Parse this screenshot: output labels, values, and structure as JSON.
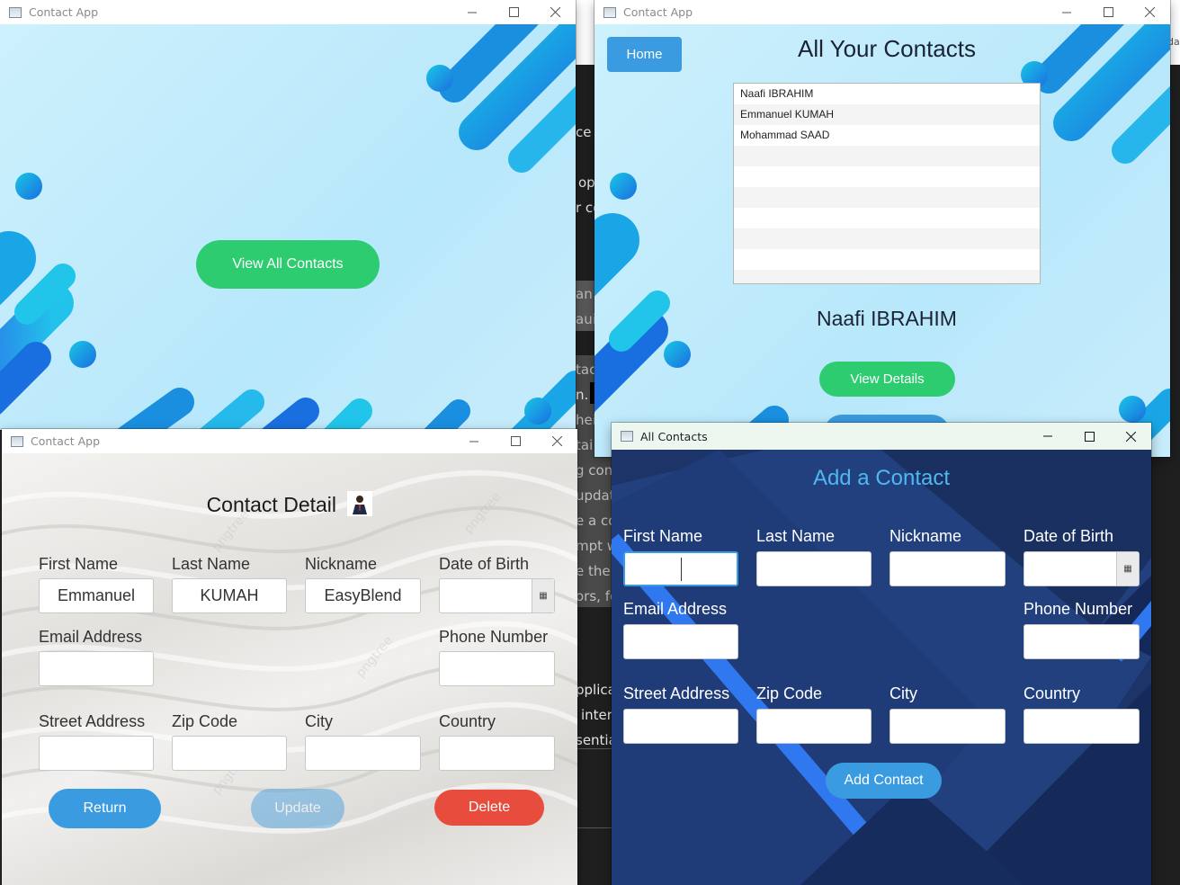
{
  "background_window": {
    "text_fragments": [
      "ce c",
      "op",
      "r co",
      "an",
      "aui",
      "tac",
      "n.",
      "hei",
      "tai",
      "g cont",
      "updat",
      "e a co",
      "mpt w",
      "e the",
      "ors, fo",
      "pplica",
      "inter",
      "sentia",
      "da"
    ]
  },
  "home_window": {
    "title": "Contact App",
    "view_all_label": "View All Contacts"
  },
  "list_window": {
    "title": "Contact App",
    "home_label": "Home",
    "heading": "All Your Contacts",
    "contacts": [
      "Naafi IBRAHIM",
      "Emmanuel KUMAH",
      "Mohammad SAAD"
    ],
    "selected_name": "Naafi IBRAHIM",
    "view_details_label": "View Details"
  },
  "detail_window": {
    "title": "Contact App",
    "heading": "Contact Detail",
    "labels": {
      "first_name": "First Name",
      "last_name": "Last Name",
      "nickname": "Nickname",
      "dob": "Date of Birth",
      "email": "Email Address",
      "phone": "Phone Number",
      "street": "Street Address",
      "zip": "Zip Code",
      "city": "City",
      "country": "Country"
    },
    "values": {
      "first_name": "Emmanuel",
      "last_name": "KUMAH",
      "nickname": "EasyBlend",
      "dob": "",
      "email": "",
      "phone": "",
      "street": "",
      "zip": "",
      "city": "",
      "country": ""
    },
    "buttons": {
      "return": "Return",
      "update": "Update",
      "delete": "Delete"
    },
    "watermark": "pngtree"
  },
  "add_window": {
    "title": "All Contacts",
    "heading": "Add a Contact",
    "labels": {
      "first_name": "First Name",
      "last_name": "Last Name",
      "nickname": "Nickname",
      "dob": "Date of Birth",
      "email": "Email Address",
      "phone": "Phone Number",
      "street": "Street Address",
      "zip": "Zip Code",
      "city": "City",
      "country": "Country"
    },
    "add_button": "Add Contact"
  },
  "colors": {
    "green": "#2ecc71",
    "blue_button": "#3a9be0",
    "red_button": "#e74c3c",
    "navy": "#1c3468",
    "light_blue_bg": "#c4ecfb"
  },
  "icons": [
    "app-icon",
    "minimize-icon",
    "maximize-icon",
    "close-icon",
    "calendar-icon",
    "person-icon"
  ]
}
